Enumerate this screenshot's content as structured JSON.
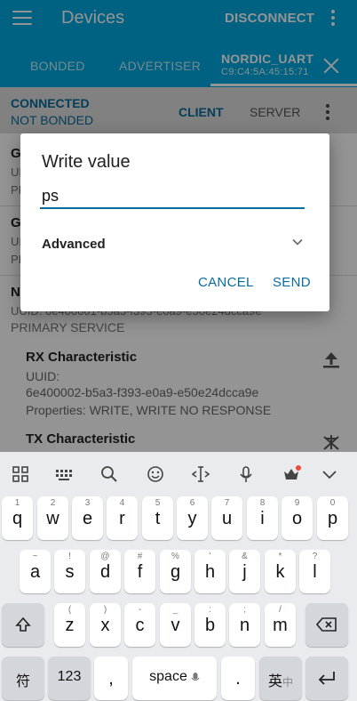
{
  "appbar": {
    "title": "Devices",
    "disconnect_label": "DISCONNECT",
    "tabs": [
      "BONDED",
      "ADVERTISER"
    ],
    "device_name": "NORDIC_UART",
    "device_mac": "C9:C4:5A:45:15:71"
  },
  "connection": {
    "status": "CONNECTED",
    "bond": "NOT BONDED",
    "client_label": "CLIENT",
    "server_label": "SERVER"
  },
  "services": [
    {
      "name": "G",
      "uuid_label": "UI",
      "type_label": "PI"
    },
    {
      "name": "G",
      "uuid_label": "UI",
      "type_label": "PI"
    },
    {
      "name": "N"
    }
  ],
  "nordic_service": {
    "uuid_line": "UUID: 6e400001-b5a3-f393-e0a9-e50e24dcca9e",
    "type_line": "PRIMARY SERVICE"
  },
  "characteristics": [
    {
      "title": "RX Characteristic",
      "uuid_label": "UUID:",
      "uuid": "6e400002-b5a3-f393-e0a9-e50e24dcca9e",
      "props_key": "Properties:",
      "props": "WRITE, WRITE NO RESPONSE"
    },
    {
      "title": "TX Characteristic"
    }
  ],
  "dialog": {
    "title": "Write value",
    "value": "ps",
    "advanced_label": "Advanced",
    "cancel_label": "CANCEL",
    "send_label": "SEND"
  },
  "keyboard": {
    "row1": [
      {
        "main": "q",
        "alt": "1"
      },
      {
        "main": "w",
        "alt": "2"
      },
      {
        "main": "e",
        "alt": "3"
      },
      {
        "main": "r",
        "alt": "4"
      },
      {
        "main": "t",
        "alt": "5"
      },
      {
        "main": "y",
        "alt": "6"
      },
      {
        "main": "u",
        "alt": "7"
      },
      {
        "main": "i",
        "alt": "8"
      },
      {
        "main": "o",
        "alt": "9"
      },
      {
        "main": "p",
        "alt": "0"
      }
    ],
    "row2": [
      {
        "main": "a",
        "alt": "~"
      },
      {
        "main": "s",
        "alt": "!"
      },
      {
        "main": "d",
        "alt": "@"
      },
      {
        "main": "f",
        "alt": "#"
      },
      {
        "main": "g",
        "alt": "%"
      },
      {
        "main": "h",
        "alt": "'"
      },
      {
        "main": "j",
        "alt": "&"
      },
      {
        "main": "k",
        "alt": "*"
      },
      {
        "main": "l",
        "alt": "?"
      }
    ],
    "row3": [
      {
        "main": "z",
        "alt": "("
      },
      {
        "main": "x",
        "alt": ")"
      },
      {
        "main": "c",
        "alt": "-"
      },
      {
        "main": "v",
        "alt": "_"
      },
      {
        "main": "b",
        "alt": ":"
      },
      {
        "main": "n",
        "alt": ";"
      },
      {
        "main": "m",
        "alt": "/"
      }
    ],
    "symbols_key": "符",
    "numbers_key": "123",
    "comma_key": ",",
    "space_key": "space",
    "period_key": ".",
    "lang_key_main": "英",
    "lang_key_alt": "中"
  }
}
